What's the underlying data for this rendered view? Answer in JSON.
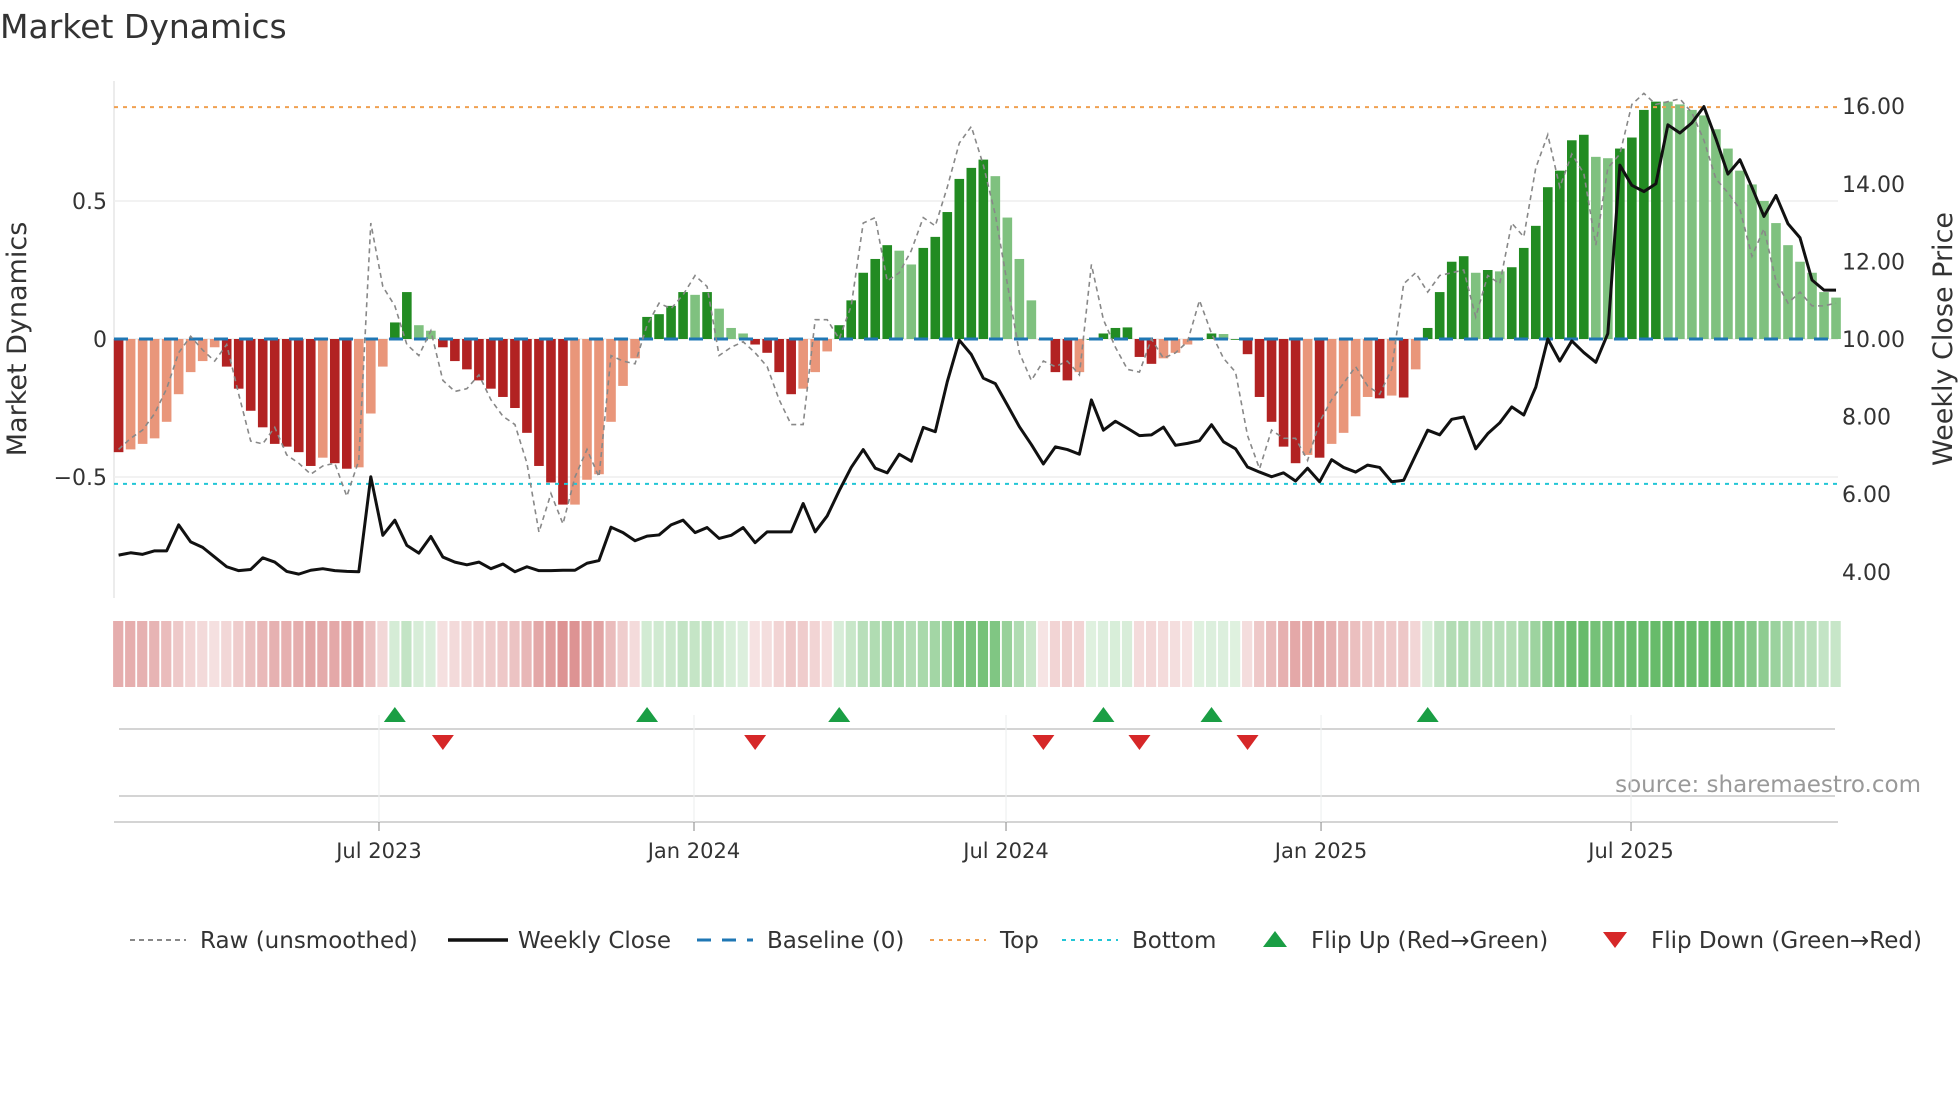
{
  "chart_data": {
    "type": "bar",
    "title": "Market Dynamics",
    "ylabel_left": "Market Dynamics",
    "ylabel_right": "Weekly Close Price",
    "ylim_left": [
      -0.938,
      0.935
    ],
    "ylim_right": [
      3.32,
      16.65
    ],
    "yticks_left": [
      {
        "v": 0.5,
        "label": "0.5"
      },
      {
        "v": 0,
        "label": "0"
      },
      {
        "v": -0.5,
        "label": "−0.5"
      }
    ],
    "yticks_right": [
      {
        "v": 16,
        "label": "16.00"
      },
      {
        "v": 14,
        "label": "14.00"
      },
      {
        "v": 12,
        "label": "12.00"
      },
      {
        "v": 10,
        "label": "10.00"
      },
      {
        "v": 8,
        "label": "8.00"
      },
      {
        "v": 6,
        "label": "6.00"
      },
      {
        "v": 4,
        "label": "4.00"
      }
    ],
    "xticks": [
      {
        "week": 21.68,
        "label": "Jul 2023"
      },
      {
        "week": 47.91,
        "label": "Jan 2024"
      },
      {
        "week": 73.89,
        "label": "Jul 2024"
      },
      {
        "week": 100.12,
        "label": "Jan 2025"
      },
      {
        "week": 125.93,
        "label": "Jul 2025"
      }
    ],
    "top_level": 0.84,
    "bottom_level": -0.525,
    "baseline": 0,
    "smoothed": [
      -0.41,
      -0.4,
      -0.38,
      -0.36,
      -0.3,
      -0.2,
      -0.12,
      -0.08,
      -0.03,
      -0.1,
      -0.18,
      -0.26,
      -0.32,
      -0.38,
      -0.39,
      -0.41,
      -0.46,
      -0.43,
      -0.45,
      -0.47,
      -0.465,
      -0.27,
      -0.1,
      0.06,
      0.17,
      0.05,
      0.03,
      -0.03,
      -0.08,
      -0.11,
      -0.15,
      -0.18,
      -0.21,
      -0.25,
      -0.34,
      -0.46,
      -0.52,
      -0.6,
      -0.6,
      -0.51,
      -0.49,
      -0.3,
      -0.17,
      -0.07,
      0.08,
      0.09,
      0.12,
      0.17,
      0.16,
      0.17,
      0.11,
      0.04,
      0.02,
      -0.02,
      -0.05,
      -0.12,
      -0.2,
      -0.18,
      -0.12,
      -0.045,
      0.05,
      0.14,
      0.24,
      0.29,
      0.34,
      0.32,
      0.27,
      0.33,
      0.37,
      0.46,
      0.58,
      0.62,
      0.65,
      0.59,
      0.44,
      0.29,
      0.14,
      -0.005,
      -0.12,
      -0.15,
      -0.12,
      0.0,
      0.02,
      0.04,
      0.042,
      -0.065,
      -0.09,
      -0.07,
      -0.05,
      -0.02,
      0.0,
      0.02,
      0.018,
      0.0,
      -0.055,
      -0.21,
      -0.3,
      -0.39,
      -0.45,
      -0.42,
      -0.43,
      -0.38,
      -0.34,
      -0.28,
      -0.21,
      -0.215,
      -0.205,
      -0.212,
      -0.11,
      0.04,
      0.17,
      0.28,
      0.3,
      0.24,
      0.25,
      0.245,
      0.26,
      0.33,
      0.41,
      0.55,
      0.61,
      0.72,
      0.74,
      0.66,
      0.655,
      0.69,
      0.73,
      0.83,
      0.86,
      0.86,
      0.85,
      0.83,
      0.81,
      0.76,
      0.69,
      0.61,
      0.56,
      0.5,
      0.42,
      0.34,
      0.28,
      0.24,
      0.17,
      0.15
    ],
    "raw": [
      -0.4,
      -0.36,
      -0.33,
      -0.27,
      -0.18,
      -0.05,
      0.01,
      -0.04,
      -0.08,
      -0.02,
      -0.2,
      -0.37,
      -0.38,
      -0.32,
      -0.42,
      -0.45,
      -0.49,
      -0.46,
      -0.45,
      -0.57,
      -0.44,
      0.42,
      0.19,
      0.12,
      -0.02,
      -0.06,
      0.03,
      -0.15,
      -0.19,
      -0.18,
      -0.13,
      -0.22,
      -0.28,
      -0.31,
      -0.45,
      -0.7,
      -0.56,
      -0.67,
      -0.5,
      -0.4,
      -0.5,
      -0.06,
      -0.08,
      -0.09,
      0.05,
      0.13,
      0.11,
      0.16,
      0.23,
      0.19,
      -0.06,
      -0.03,
      -0.01,
      -0.05,
      -0.1,
      -0.22,
      -0.31,
      -0.31,
      0.07,
      0.07,
      0.0,
      0.12,
      0.42,
      0.44,
      0.21,
      0.24,
      0.32,
      0.44,
      0.41,
      0.55,
      0.71,
      0.77,
      0.63,
      0.45,
      0.2,
      -0.05,
      -0.15,
      -0.08,
      -0.1,
      -0.08,
      -0.13,
      0.27,
      0.07,
      -0.03,
      -0.11,
      -0.12,
      0.0,
      -0.07,
      -0.05,
      -0.01,
      0.14,
      0.02,
      -0.07,
      -0.12,
      -0.35,
      -0.47,
      -0.33,
      -0.36,
      -0.36,
      -0.44,
      -0.3,
      -0.22,
      -0.16,
      -0.1,
      -0.17,
      -0.2,
      -0.11,
      0.2,
      0.24,
      0.17,
      0.23,
      0.24,
      0.25,
      0.08,
      0.23,
      0.2,
      0.42,
      0.37,
      0.62,
      0.74,
      0.55,
      0.67,
      0.6,
      0.34,
      0.62,
      0.67,
      0.85,
      0.89,
      0.85,
      0.86,
      0.87,
      0.82,
      0.72,
      0.58,
      0.53,
      0.47,
      0.3,
      0.4,
      0.21,
      0.13,
      0.17,
      0.12,
      0.12,
      0.13
    ],
    "close": [
      4.43,
      4.49,
      4.45,
      4.54,
      4.54,
      5.21,
      4.77,
      4.63,
      4.38,
      4.13,
      4.03,
      4.06,
      4.36,
      4.25,
      4.01,
      3.94,
      4.04,
      4.08,
      4.03,
      4.01,
      4.0,
      6.45,
      4.94,
      5.33,
      4.68,
      4.48,
      4.91,
      4.38,
      4.25,
      4.18,
      4.25,
      4.08,
      4.2,
      4.0,
      4.13,
      4.03,
      4.03,
      4.04,
      4.04,
      4.22,
      4.29,
      5.15,
      5.01,
      4.8,
      4.92,
      4.95,
      5.21,
      5.33,
      5.01,
      5.14,
      4.86,
      4.94,
      5.14,
      4.75,
      5.03,
      5.03,
      5.03,
      5.76,
      5.03,
      5.44,
      6.09,
      6.69,
      7.15,
      6.67,
      6.55,
      7.03,
      6.85,
      7.72,
      7.61,
      8.9,
      9.97,
      9.6,
      8.99,
      8.85,
      8.3,
      7.74,
      7.28,
      6.78,
      7.22,
      7.15,
      7.03,
      8.43,
      7.65,
      7.88,
      7.7,
      7.51,
      7.53,
      7.73,
      7.26,
      7.31,
      7.38,
      7.79,
      7.35,
      7.17,
      6.7,
      6.57,
      6.45,
      6.55,
      6.34,
      6.67,
      6.32,
      6.89,
      6.69,
      6.57,
      6.75,
      6.69,
      6.32,
      6.36,
      7.01,
      7.65,
      7.53,
      7.93,
      7.99,
      7.17,
      7.56,
      7.84,
      8.25,
      8.04,
      8.76,
      10.0,
      9.43,
      9.95,
      9.65,
      9.4,
      10.14,
      14.48,
      13.96,
      13.8,
      14.0,
      15.52,
      15.31,
      15.57,
      15.99,
      15.16,
      14.25,
      14.62,
      13.91,
      13.16,
      13.7,
      12.97,
      12.61,
      11.52,
      11.26,
      11.26
    ],
    "flip_up_weeks": [
      24,
      45,
      61,
      83,
      92,
      110
    ],
    "flip_down_weeks": [
      28,
      54,
      78,
      86,
      95
    ],
    "legend": [
      {
        "key": "raw",
        "label": "Raw (unsmoothed)"
      },
      {
        "key": "close",
        "label": "Weekly Close"
      },
      {
        "key": "baseline",
        "label": "Baseline (0)"
      },
      {
        "key": "top",
        "label": "Top"
      },
      {
        "key": "bottom",
        "label": "Bottom"
      },
      {
        "key": "up",
        "label": "Flip Up (Red→Green)"
      },
      {
        "key": "down",
        "label": "Flip Down (Green→Red)"
      }
    ],
    "legend_placement": "bottom",
    "source": "source: sharemaestro.com",
    "colors": {
      "green_strong": "#228b22",
      "green_weak": "#7fc17f",
      "red_strong": "#b22222",
      "red_weak": "#e9967a",
      "heat_green": "#4caf50",
      "heat_red": "#d06a6a",
      "raw": "#888888",
      "close": "#111111",
      "baseline": "#1f77b4",
      "top": "#f0a050",
      "bottom": "#22c6d6",
      "up": "#1a9e44",
      "down": "#d62728"
    }
  }
}
